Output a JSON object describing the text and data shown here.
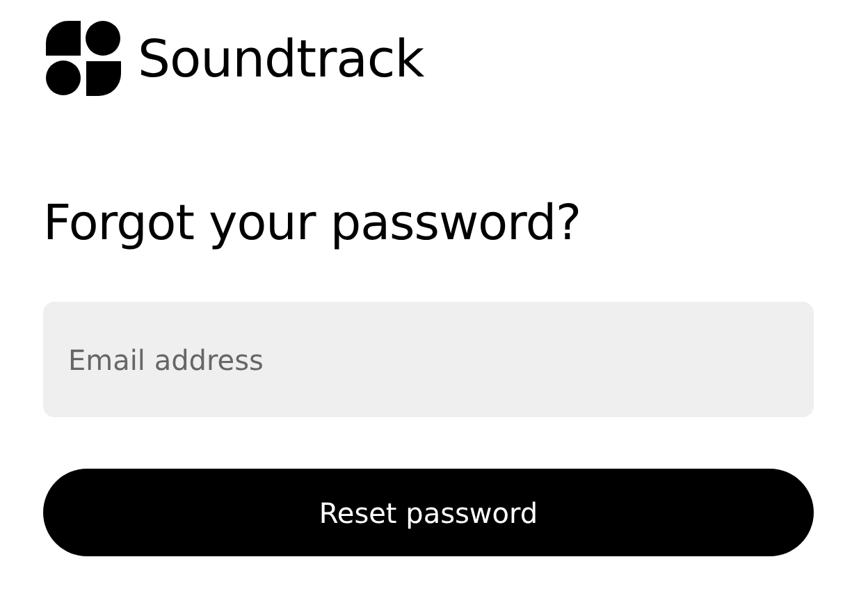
{
  "logo": {
    "name": "Soundtrack"
  },
  "heading": "Forgot your password?",
  "email_field": {
    "placeholder": "Email address"
  },
  "submit_button": {
    "label": "Reset password"
  }
}
